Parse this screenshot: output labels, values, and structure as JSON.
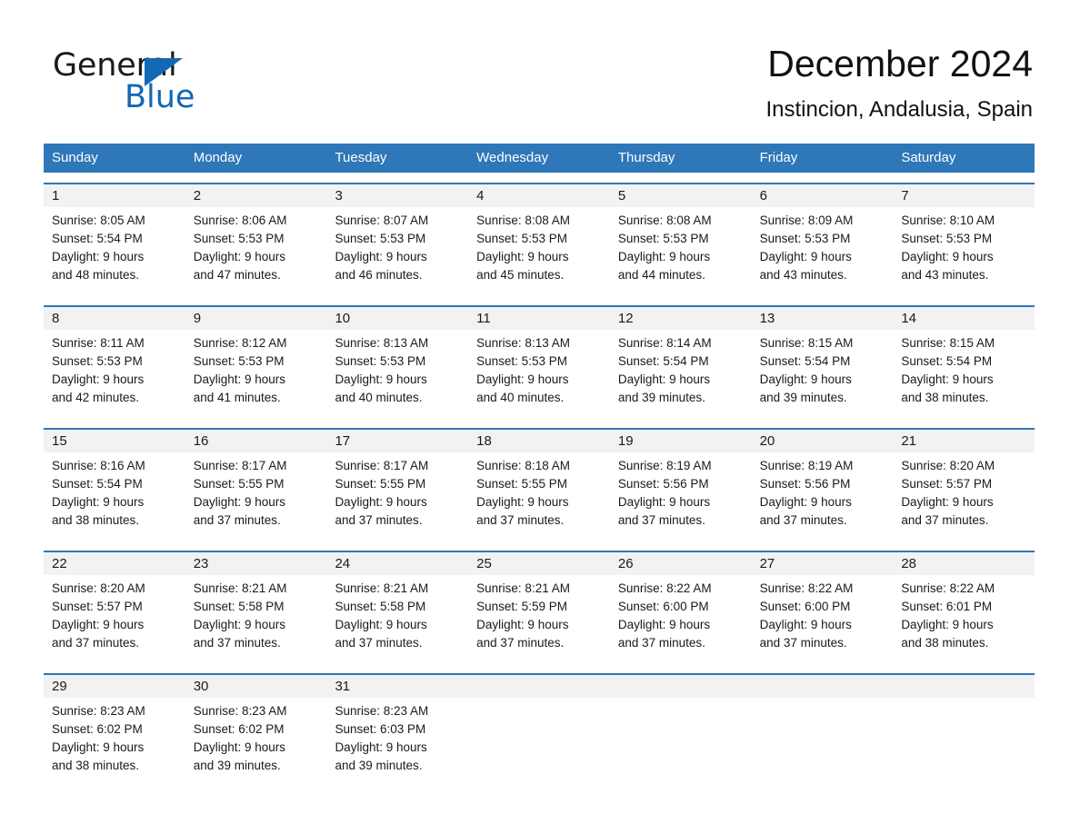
{
  "brand": {
    "name_part1": "General",
    "name_part2": "Blue",
    "triangle_color": "#1268b3"
  },
  "header": {
    "title": "December 2024",
    "subtitle": "Instincion, Andalusia, Spain"
  },
  "theme": {
    "header_blue": "#2e77b8",
    "daynum_gray": "#f2f2f2",
    "text": "#1a1a1a",
    "page_background": "#ffffff"
  },
  "weekdays": [
    "Sunday",
    "Monday",
    "Tuesday",
    "Wednesday",
    "Thursday",
    "Friday",
    "Saturday"
  ],
  "weeks": [
    {
      "days": [
        {
          "num": "1",
          "sunrise": "Sunrise: 8:05 AM",
          "sunset": "Sunset: 5:54 PM",
          "daylight1": "Daylight: 9 hours",
          "daylight2": "and 48 minutes."
        },
        {
          "num": "2",
          "sunrise": "Sunrise: 8:06 AM",
          "sunset": "Sunset: 5:53 PM",
          "daylight1": "Daylight: 9 hours",
          "daylight2": "and 47 minutes."
        },
        {
          "num": "3",
          "sunrise": "Sunrise: 8:07 AM",
          "sunset": "Sunset: 5:53 PM",
          "daylight1": "Daylight: 9 hours",
          "daylight2": "and 46 minutes."
        },
        {
          "num": "4",
          "sunrise": "Sunrise: 8:08 AM",
          "sunset": "Sunset: 5:53 PM",
          "daylight1": "Daylight: 9 hours",
          "daylight2": "and 45 minutes."
        },
        {
          "num": "5",
          "sunrise": "Sunrise: 8:08 AM",
          "sunset": "Sunset: 5:53 PM",
          "daylight1": "Daylight: 9 hours",
          "daylight2": "and 44 minutes."
        },
        {
          "num": "6",
          "sunrise": "Sunrise: 8:09 AM",
          "sunset": "Sunset: 5:53 PM",
          "daylight1": "Daylight: 9 hours",
          "daylight2": "and 43 minutes."
        },
        {
          "num": "7",
          "sunrise": "Sunrise: 8:10 AM",
          "sunset": "Sunset: 5:53 PM",
          "daylight1": "Daylight: 9 hours",
          "daylight2": "and 43 minutes."
        }
      ]
    },
    {
      "days": [
        {
          "num": "8",
          "sunrise": "Sunrise: 8:11 AM",
          "sunset": "Sunset: 5:53 PM",
          "daylight1": "Daylight: 9 hours",
          "daylight2": "and 42 minutes."
        },
        {
          "num": "9",
          "sunrise": "Sunrise: 8:12 AM",
          "sunset": "Sunset: 5:53 PM",
          "daylight1": "Daylight: 9 hours",
          "daylight2": "and 41 minutes."
        },
        {
          "num": "10",
          "sunrise": "Sunrise: 8:13 AM",
          "sunset": "Sunset: 5:53 PM",
          "daylight1": "Daylight: 9 hours",
          "daylight2": "and 40 minutes."
        },
        {
          "num": "11",
          "sunrise": "Sunrise: 8:13 AM",
          "sunset": "Sunset: 5:53 PM",
          "daylight1": "Daylight: 9 hours",
          "daylight2": "and 40 minutes."
        },
        {
          "num": "12",
          "sunrise": "Sunrise: 8:14 AM",
          "sunset": "Sunset: 5:54 PM",
          "daylight1": "Daylight: 9 hours",
          "daylight2": "and 39 minutes."
        },
        {
          "num": "13",
          "sunrise": "Sunrise: 8:15 AM",
          "sunset": "Sunset: 5:54 PM",
          "daylight1": "Daylight: 9 hours",
          "daylight2": "and 39 minutes."
        },
        {
          "num": "14",
          "sunrise": "Sunrise: 8:15 AM",
          "sunset": "Sunset: 5:54 PM",
          "daylight1": "Daylight: 9 hours",
          "daylight2": "and 38 minutes."
        }
      ]
    },
    {
      "days": [
        {
          "num": "15",
          "sunrise": "Sunrise: 8:16 AM",
          "sunset": "Sunset: 5:54 PM",
          "daylight1": "Daylight: 9 hours",
          "daylight2": "and 38 minutes."
        },
        {
          "num": "16",
          "sunrise": "Sunrise: 8:17 AM",
          "sunset": "Sunset: 5:55 PM",
          "daylight1": "Daylight: 9 hours",
          "daylight2": "and 37 minutes."
        },
        {
          "num": "17",
          "sunrise": "Sunrise: 8:17 AM",
          "sunset": "Sunset: 5:55 PM",
          "daylight1": "Daylight: 9 hours",
          "daylight2": "and 37 minutes."
        },
        {
          "num": "18",
          "sunrise": "Sunrise: 8:18 AM",
          "sunset": "Sunset: 5:55 PM",
          "daylight1": "Daylight: 9 hours",
          "daylight2": "and 37 minutes."
        },
        {
          "num": "19",
          "sunrise": "Sunrise: 8:19 AM",
          "sunset": "Sunset: 5:56 PM",
          "daylight1": "Daylight: 9 hours",
          "daylight2": "and 37 minutes."
        },
        {
          "num": "20",
          "sunrise": "Sunrise: 8:19 AM",
          "sunset": "Sunset: 5:56 PM",
          "daylight1": "Daylight: 9 hours",
          "daylight2": "and 37 minutes."
        },
        {
          "num": "21",
          "sunrise": "Sunrise: 8:20 AM",
          "sunset": "Sunset: 5:57 PM",
          "daylight1": "Daylight: 9 hours",
          "daylight2": "and 37 minutes."
        }
      ]
    },
    {
      "days": [
        {
          "num": "22",
          "sunrise": "Sunrise: 8:20 AM",
          "sunset": "Sunset: 5:57 PM",
          "daylight1": "Daylight: 9 hours",
          "daylight2": "and 37 minutes."
        },
        {
          "num": "23",
          "sunrise": "Sunrise: 8:21 AM",
          "sunset": "Sunset: 5:58 PM",
          "daylight1": "Daylight: 9 hours",
          "daylight2": "and 37 minutes."
        },
        {
          "num": "24",
          "sunrise": "Sunrise: 8:21 AM",
          "sunset": "Sunset: 5:58 PM",
          "daylight1": "Daylight: 9 hours",
          "daylight2": "and 37 minutes."
        },
        {
          "num": "25",
          "sunrise": "Sunrise: 8:21 AM",
          "sunset": "Sunset: 5:59 PM",
          "daylight1": "Daylight: 9 hours",
          "daylight2": "and 37 minutes."
        },
        {
          "num": "26",
          "sunrise": "Sunrise: 8:22 AM",
          "sunset": "Sunset: 6:00 PM",
          "daylight1": "Daylight: 9 hours",
          "daylight2": "and 37 minutes."
        },
        {
          "num": "27",
          "sunrise": "Sunrise: 8:22 AM",
          "sunset": "Sunset: 6:00 PM",
          "daylight1": "Daylight: 9 hours",
          "daylight2": "and 37 minutes."
        },
        {
          "num": "28",
          "sunrise": "Sunrise: 8:22 AM",
          "sunset": "Sunset: 6:01 PM",
          "daylight1": "Daylight: 9 hours",
          "daylight2": "and 38 minutes."
        }
      ]
    },
    {
      "days": [
        {
          "num": "29",
          "sunrise": "Sunrise: 8:23 AM",
          "sunset": "Sunset: 6:02 PM",
          "daylight1": "Daylight: 9 hours",
          "daylight2": "and 38 minutes."
        },
        {
          "num": "30",
          "sunrise": "Sunrise: 8:23 AM",
          "sunset": "Sunset: 6:02 PM",
          "daylight1": "Daylight: 9 hours",
          "daylight2": "and 39 minutes."
        },
        {
          "num": "31",
          "sunrise": "Sunrise: 8:23 AM",
          "sunset": "Sunset: 6:03 PM",
          "daylight1": "Daylight: 9 hours",
          "daylight2": "and 39 minutes."
        },
        {
          "num": "",
          "sunrise": "",
          "sunset": "",
          "daylight1": "",
          "daylight2": ""
        },
        {
          "num": "",
          "sunrise": "",
          "sunset": "",
          "daylight1": "",
          "daylight2": ""
        },
        {
          "num": "",
          "sunrise": "",
          "sunset": "",
          "daylight1": "",
          "daylight2": ""
        },
        {
          "num": "",
          "sunrise": "",
          "sunset": "",
          "daylight1": "",
          "daylight2": ""
        }
      ]
    }
  ]
}
